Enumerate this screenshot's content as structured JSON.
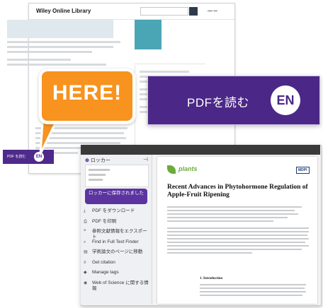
{
  "wiley": {
    "brand": "Wiley Online Library",
    "pdf_label": "PDF を読む",
    "pdf_en": "EN"
  },
  "zoom": {
    "label": "PDFを読む",
    "en": "EN"
  },
  "bubble": {
    "text": "HERE!"
  },
  "reader": {
    "sidebar": {
      "title": "ロッカー",
      "collapse_icon": "⊣",
      "save_button": "ロッカーに保存されました",
      "items": [
        {
          "icon": "download-icon",
          "glyph": "⤓",
          "label": "PDF をダウンロード"
        },
        {
          "icon": "print-icon",
          "glyph": "⎙",
          "label": "PDF を印刷"
        },
        {
          "icon": "quote-icon",
          "glyph": "❝",
          "label": "参照文献情報をエクスポート"
        },
        {
          "icon": "search-icon",
          "glyph": "⌕",
          "label": "Find in Full Text Finder"
        },
        {
          "icon": "document-icon",
          "glyph": "▤",
          "label": "学術論文のページに移動"
        },
        {
          "icon": "share-icon",
          "glyph": "≡",
          "label": "Get citation"
        },
        {
          "icon": "tag-icon",
          "glyph": "◆",
          "label": "Manage tags"
        },
        {
          "icon": "globe-icon",
          "glyph": "◉",
          "label": "Web of Science に関する情報"
        }
      ]
    },
    "paper": {
      "journal": "plants",
      "publisher": "MDPI",
      "title": "Recent Advances in Phytohormone Regulation of Apple-Fruit Ripening",
      "intro_heading": "1. Introduction"
    }
  }
}
